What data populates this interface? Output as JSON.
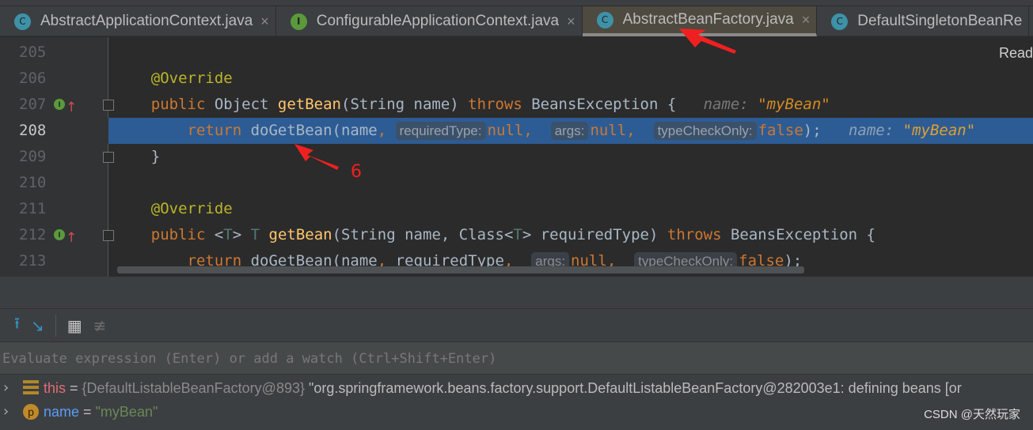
{
  "tabs": [
    {
      "label": "AbstractApplicationContext.java",
      "icon": "class-icon",
      "kind": "c",
      "active": false,
      "close": "×"
    },
    {
      "label": "ConfigurableApplicationContext.java",
      "icon": "interface-icon",
      "kind": "i",
      "active": false,
      "close": "×"
    },
    {
      "label": "AbstractBeanFactory.java",
      "icon": "class-icon",
      "kind": "c",
      "active": true,
      "close": "×"
    },
    {
      "label": "DefaultSingletonBeanRe",
      "icon": "class-icon",
      "kind": "c",
      "active": false,
      "close": ""
    }
  ],
  "editor": {
    "reader_mode": "Read",
    "highlight_color": "#2d5c94",
    "lines": [
      {
        "num": "205",
        "tokens": []
      },
      {
        "num": "206",
        "tokens": [
          [
            "    @Override",
            "ann"
          ]
        ]
      },
      {
        "num": "207",
        "marker": "I",
        "tokens": [
          [
            "    public ",
            "kw"
          ],
          [
            "Object ",
            ""
          ],
          [
            "getBean",
            "fn"
          ],
          [
            "(String name) ",
            ""
          ],
          [
            "throws ",
            "kw"
          ],
          [
            "BeansException {",
            ""
          ],
          [
            "   name: ",
            "inl"
          ],
          [
            "\"myBean\"",
            "inls"
          ]
        ]
      },
      {
        "num": "208",
        "highlight": true,
        "tokens": [
          [
            "        return ",
            "kw"
          ],
          [
            "doGetBean(name",
            ""
          ],
          [
            ", ",
            "kw"
          ],
          [
            "requiredType:",
            "hint"
          ],
          [
            "null",
            "kw"
          ],
          [
            ",  ",
            "kw"
          ],
          [
            "args:",
            "hint"
          ],
          [
            "null",
            "kw"
          ],
          [
            ",  ",
            "kw"
          ],
          [
            "typeCheckOnly:",
            "hint"
          ],
          [
            "false",
            "kw"
          ],
          [
            ");",
            ""
          ],
          [
            "   name: ",
            "inl"
          ],
          [
            "\"myBean\"",
            "inls"
          ]
        ]
      },
      {
        "num": "209",
        "tokens": [
          [
            "    }",
            ""
          ]
        ]
      },
      {
        "num": "210",
        "tokens": []
      },
      {
        "num": "211",
        "tokens": [
          [
            "    @Override",
            "ann"
          ]
        ]
      },
      {
        "num": "212",
        "marker": "I",
        "tokens": [
          [
            "    public ",
            "kw"
          ],
          [
            "<",
            ""
          ],
          [
            "T",
            "tp"
          ],
          [
            "> ",
            ""
          ],
          [
            "T ",
            "tp"
          ],
          [
            "getBean",
            "fn"
          ],
          [
            "(String name, Class<",
            ""
          ],
          [
            "T",
            "tp"
          ],
          [
            "> requiredType) ",
            ""
          ],
          [
            "throws ",
            "kw"
          ],
          [
            "BeansException {",
            ""
          ]
        ]
      },
      {
        "num": "213",
        "tokens": [
          [
            "        return ",
            "kw"
          ],
          [
            "doGetBean(name",
            ""
          ],
          [
            ", ",
            "kw"
          ],
          [
            "requiredType",
            ""
          ],
          [
            ",  ",
            "kw"
          ],
          [
            "args:",
            "hint"
          ],
          [
            "null",
            "kw"
          ],
          [
            ",  ",
            "kw"
          ],
          [
            "typeCheckOnly:",
            "hint"
          ],
          [
            "false",
            "kw"
          ],
          [
            ");",
            ""
          ]
        ]
      }
    ]
  },
  "annotation": {
    "step_number": "6",
    "color": "#f02020"
  },
  "debug": {
    "toolbar": [
      {
        "icon": "step-out-icon",
        "glyph": "⭱"
      },
      {
        "icon": "step-into-cursor-icon",
        "glyph": "↘"
      },
      {
        "icon": "evaluate-calculator-icon",
        "glyph": "▦"
      },
      {
        "icon": "restore-layout-icon",
        "glyph": "≢"
      }
    ],
    "evaluate_placeholder": "Evaluate expression (Enter) or add a watch (Ctrl+Shift+Enter)",
    "variables": [
      {
        "name": "this",
        "eq": " = ",
        "type": "{DefaultListableBeanFactory@893}",
        "value": " \"org.springframework.beans.factory.support.DefaultListableBeanFactory@282003e1: defining beans [or",
        "icon": "field-icon"
      },
      {
        "name": "name",
        "eq": " = ",
        "type": "",
        "value": "\"myBean\"",
        "icon": "parameter-icon"
      }
    ]
  },
  "watermark": "CSDN @天然玩家"
}
